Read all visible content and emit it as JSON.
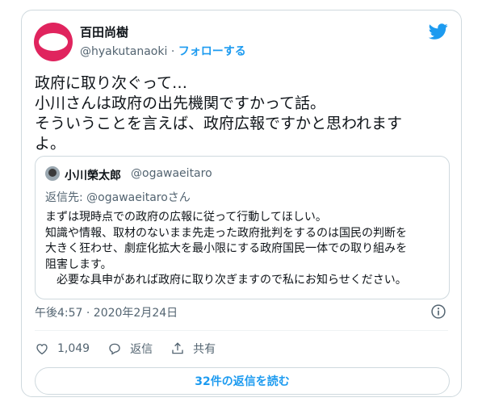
{
  "author": {
    "name": "百田尚樹",
    "handle": "@hyakutanaoki",
    "separator": " · ",
    "follow_label": "フォローする"
  },
  "tweet": {
    "lines": [
      "政府に取り次ぐって…",
      "小川さんは政府の出先機関ですかって話。",
      "そういうことを言えば、政府広報ですかと思われます",
      "よ。"
    ]
  },
  "quoted": {
    "name": "小川榮太郎",
    "handle": "@ogawaeitaro",
    "reply_to": "返信先: @ogawaeitaroさん",
    "lines": [
      "まずは現時点での政府の広報に従って行動してほしい。",
      "知識や情報、取材のないまま先走った政府批判をするのは国民の判断を",
      "大きく狂わせ、劇症化拡大を最小限にする政府国民一体での取り組みを",
      "阻害します。",
      "　必要な具申があれば政府に取り次ぎますので私にお知らせください。"
    ]
  },
  "timestamp": "午後4:57 · 2020年2月24日",
  "actions": {
    "like_count": "1,049",
    "reply_label": "返信",
    "share_label": "共有"
  },
  "replies_button_label": "32件の返信を読む",
  "icons": {
    "brand": "twitter-bird-icon",
    "accent": "#1d9bf0",
    "avatar_color": "#e0245e"
  }
}
